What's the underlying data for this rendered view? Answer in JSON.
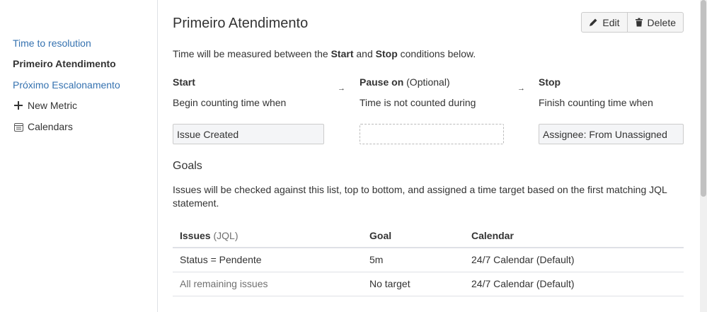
{
  "sidebar": {
    "items": [
      {
        "label": "Time to resolution"
      },
      {
        "label": "Primeiro Atendimento"
      },
      {
        "label": "Próximo Escalonamento"
      },
      {
        "label": "New Metric",
        "icon": "plus-icon"
      },
      {
        "label": "Calendars",
        "icon": "calendar-icon"
      }
    ]
  },
  "header": {
    "title": "Primeiro Atendimento",
    "edit_label": "Edit",
    "delete_label": "Delete"
  },
  "intro": {
    "prefix": "Time will be measured between the ",
    "start_word": "Start",
    "and_word": " and ",
    "stop_word": "Stop",
    "suffix": " conditions below."
  },
  "conditions": {
    "start": {
      "title": "Start",
      "desc": "Begin counting time when",
      "value": "Issue Created"
    },
    "pause": {
      "title": "Pause on",
      "optional": "(Optional)",
      "desc": "Time is not counted during",
      "value": ""
    },
    "stop": {
      "title": "Stop",
      "desc": "Finish counting time when",
      "value": "Assignee: From Unassigned"
    },
    "arrow": "→"
  },
  "goals": {
    "title": "Goals",
    "desc": "Issues will be checked against this list, top to bottom, and assigned a time target based on the first matching JQL statement.",
    "columns": {
      "issues": "Issues",
      "issues_hint": "(JQL)",
      "goal": "Goal",
      "calendar": "Calendar"
    },
    "rows": [
      {
        "issues": "Status = Pendente",
        "goal": "5m",
        "calendar": "24/7 Calendar (Default)"
      },
      {
        "issues": "All remaining issues",
        "goal": "No target",
        "calendar": "24/7 Calendar (Default)"
      }
    ]
  },
  "colors": {
    "link": "#3572b0",
    "border": "#dfe1e6",
    "text": "#333333"
  }
}
